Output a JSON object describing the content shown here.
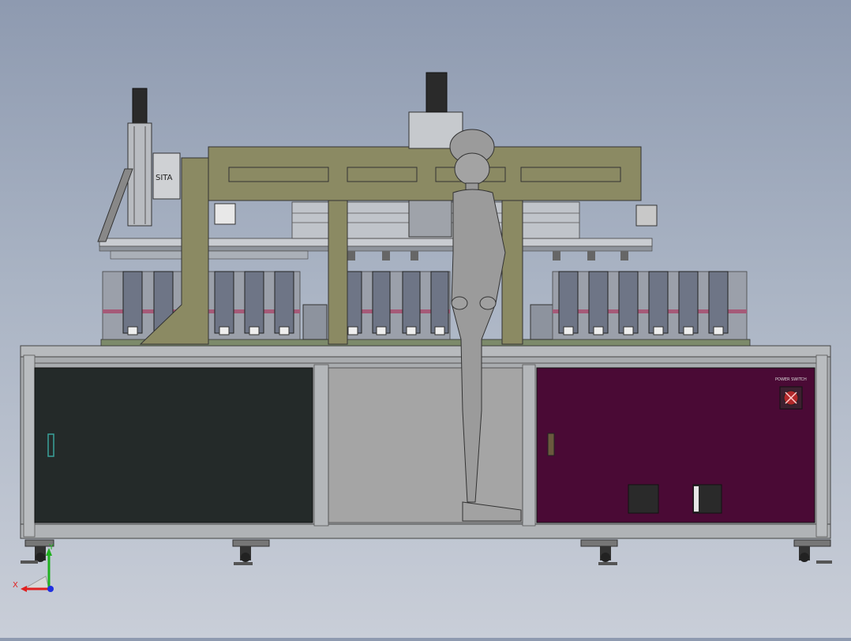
{
  "model": {
    "gantry_label": "SITA",
    "panel_label": "POWER SWITCH"
  },
  "triad": {
    "x_label": "X",
    "y_label": "Y"
  },
  "colors": {
    "background_top": "#8e9ab0",
    "background_bottom": "#c9ced8",
    "gantry": "#8b8a63",
    "frame": "#a9acaf",
    "left_door": "#242a29",
    "center_panel": "#a5a5a5",
    "right_door": "#4a0a35",
    "station": "#6e7586",
    "figure": "#9b9b9b",
    "axis_x": "#e02020",
    "axis_y": "#20b020",
    "axis_z": "#2030e0"
  }
}
